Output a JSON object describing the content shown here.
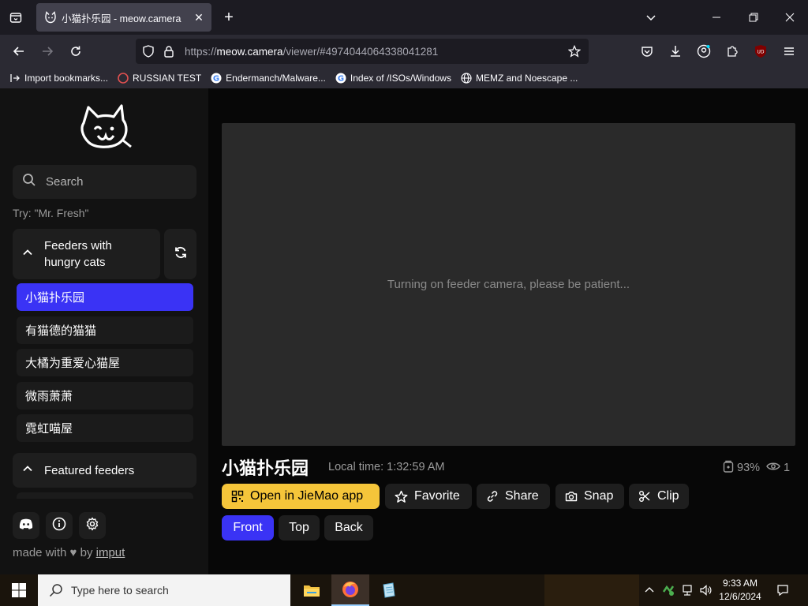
{
  "browser": {
    "tab_title": "小猫扑乐园 - meow.camera",
    "url_prefix": "https://",
    "url_host": "meow.camera",
    "url_path": "/viewer/#4974044064338041281",
    "bookmarks": [
      {
        "label": "Import bookmarks...",
        "icon": "import-icon"
      },
      {
        "label": "RUSSIAN TEST",
        "icon": "github-icon"
      },
      {
        "label": "Endermanch/Malware...",
        "icon": "google-icon"
      },
      {
        "label": "Index of /ISOs/Windows",
        "icon": "google-icon"
      },
      {
        "label": "MEMZ and Noescape ...",
        "icon": "globe-icon"
      }
    ]
  },
  "sidebar": {
    "search_placeholder": "Search",
    "try_hint": "Try: \"Mr. Fresh\"",
    "section1_title_line1": "Feeders with",
    "section1_title_line2": "hungry cats",
    "feeders": [
      "小猫扑乐园",
      "有猫德的猫猫",
      "大橘为重爱心猫屋",
      "微雨萧萧",
      "霓虹喵屋"
    ],
    "section2_title": "Featured feeders",
    "made_with_prefix": "made with",
    "made_with_by": "by",
    "made_with_author": "imput"
  },
  "viewer": {
    "status_message": "Turning on feeder camera, please be patient...",
    "feeder_name": "小猫扑乐园",
    "local_time": "Local time: 1:32:59 AM",
    "food_level": "93%",
    "viewer_count": "1",
    "actions": {
      "open_app": "Open in JieMao app",
      "favorite": "Favorite",
      "share": "Share",
      "snap": "Snap",
      "clip": "Clip"
    },
    "views": [
      "Front",
      "Top",
      "Back"
    ]
  },
  "taskbar": {
    "search_placeholder": "Type here to search",
    "time": "9:33 AM",
    "date": "12/6/2024"
  },
  "colors": {
    "accent": "#3a33f5",
    "primary_button": "#f5c53a"
  }
}
